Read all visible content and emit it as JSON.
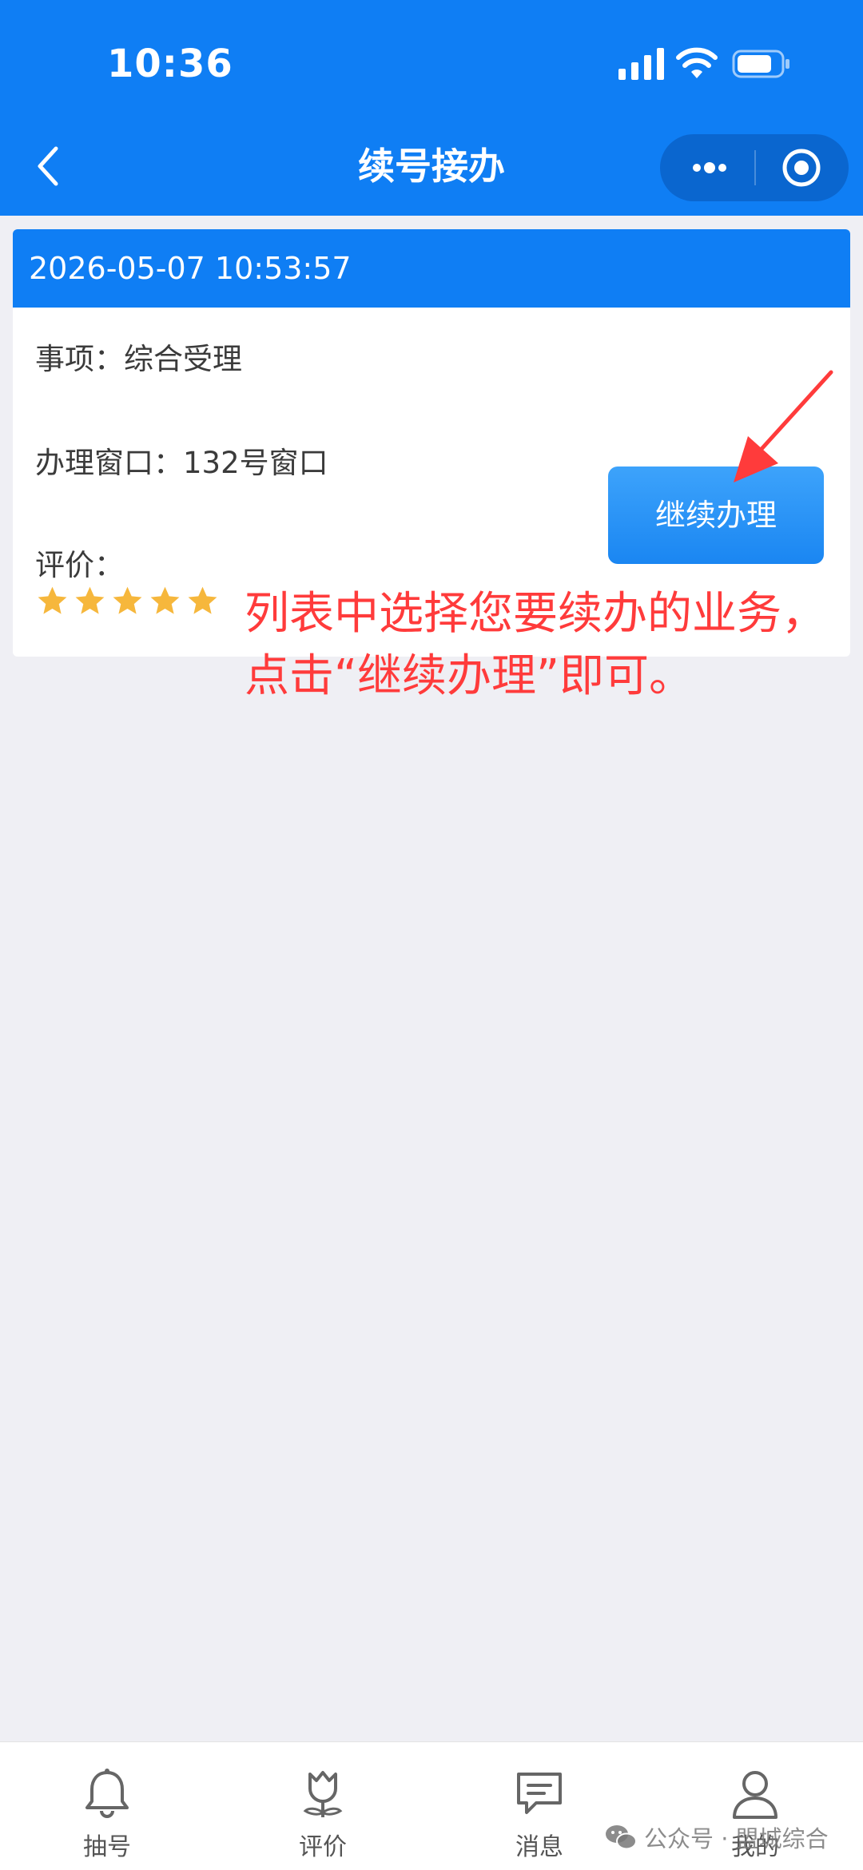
{
  "status_bar": {
    "time": "10:36"
  },
  "nav": {
    "title": "续号接办"
  },
  "record": {
    "datetime": "2026-05-07 10:53:57",
    "item_label": "事项：",
    "item_value": "综合受理",
    "window_label": "办理窗口：",
    "window_value": "132号窗口",
    "rating_label": "评价：",
    "stars": 5,
    "continue_button": "继续办理"
  },
  "annotation": {
    "line1": "列表中选择您要续办的业务，",
    "line2": "点击“继续办理”即可。"
  },
  "tabbar": {
    "tabs": [
      {
        "label": "抽号",
        "icon": "bell-icon"
      },
      {
        "label": "评价",
        "icon": "flower-icon"
      },
      {
        "label": "消息",
        "icon": "message-icon"
      },
      {
        "label": "我的",
        "icon": "user-icon"
      }
    ]
  },
  "watermark": {
    "text": "公众号 · 盟城综合"
  },
  "colors": {
    "primary": "#0f7ef4",
    "annotation": "#ff3b3b",
    "star": "#f6b73c",
    "background": "#efeff4"
  }
}
